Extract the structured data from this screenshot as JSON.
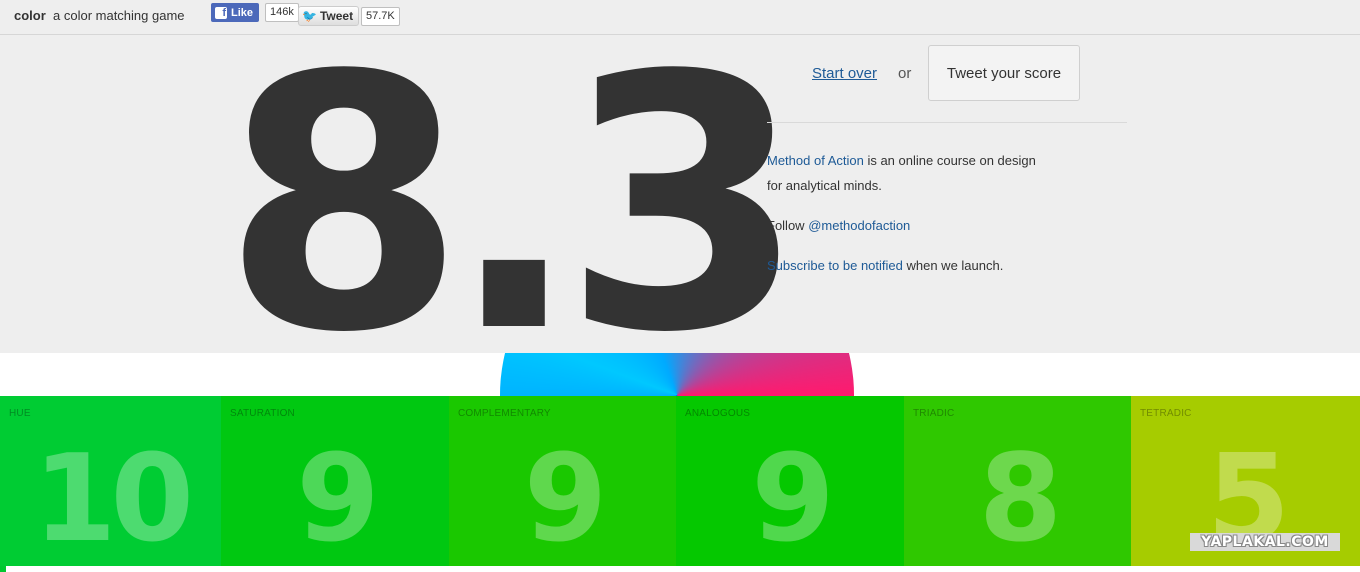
{
  "header": {
    "brand": "color",
    "tagline": "a color matching game",
    "fb_like_label": "Like",
    "fb_like_count": "146k",
    "tweet_label": "Tweet",
    "tweet_count": "57.7K"
  },
  "score": {
    "value": "8.3"
  },
  "actions": {
    "start_over": "Start over",
    "or": "or",
    "tweet_score": "Tweet your score"
  },
  "info": {
    "course_link": "Method of Action",
    "course_text_1": " is an online course on design",
    "course_text_2": "for analytical minds.",
    "follow_text": "Follow ",
    "follow_handle": "@methodofaction",
    "subscribe_link": "Subscribe to be notified",
    "subscribe_text": " when we launch."
  },
  "categories": [
    {
      "label": "HUE",
      "score": "10",
      "color": "#00cc33",
      "width": 221
    },
    {
      "label": "SATURATION",
      "score": "9",
      "color": "#00c811",
      "width": 228
    },
    {
      "label": "COMPLEMENTARY",
      "score": "9",
      "color": "#1ac800",
      "width": 227
    },
    {
      "label": "ANALOGOUS",
      "score": "9",
      "color": "#05c800",
      "width": 228
    },
    {
      "label": "TRIADIC",
      "score": "8",
      "color": "#2fc800",
      "width": 227
    },
    {
      "label": "TETRADIC",
      "score": "5",
      "color": "#a6cc00",
      "width": 229
    }
  ],
  "watermark": "YAPLAKAL.COM"
}
